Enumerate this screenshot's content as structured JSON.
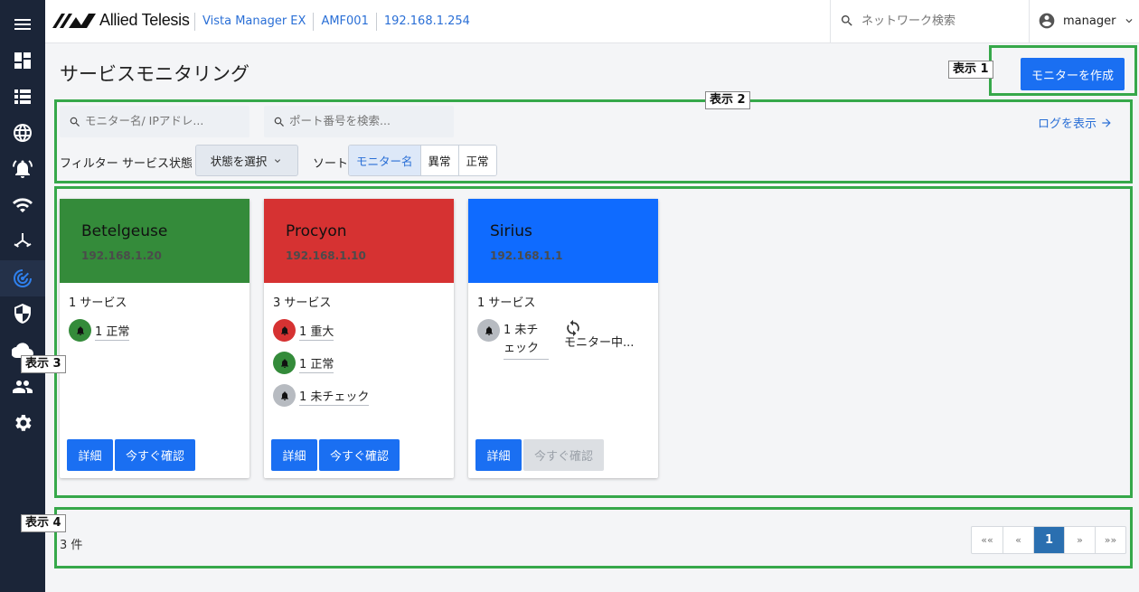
{
  "header": {
    "brand": "Allied Telesis",
    "breadcrumbs": [
      "Vista Manager EX",
      "AMF001",
      "192.168.1.254"
    ],
    "search_placeholder": "ネットワーク検索",
    "user": "manager"
  },
  "sidebar": {
    "items": [
      {
        "icon": "menu-icon"
      },
      {
        "icon": "dashboard-icon"
      },
      {
        "icon": "list-icon"
      },
      {
        "icon": "globe-icon"
      },
      {
        "icon": "alarm-icon"
      },
      {
        "icon": "wifi-icon"
      },
      {
        "icon": "network-topology-icon"
      },
      {
        "icon": "monitoring-icon",
        "active": true
      },
      {
        "icon": "shield-icon"
      },
      {
        "icon": "cloud-icon"
      },
      {
        "icon": "users-icon"
      },
      {
        "icon": "settings-icon"
      }
    ]
  },
  "page": {
    "title": "サービスモニタリング",
    "create_button": "モニターを作成"
  },
  "annotations": [
    "表示 1",
    "表示 2",
    "表示 3",
    "表示 4"
  ],
  "filters": {
    "monitor_search_placeholder": "モニター名/ IPアドレ...",
    "port_search_placeholder": "ポート番号を検索...",
    "logs_link": "ログを表示",
    "filter_label": "フィルター",
    "service_status_label": "サービス状態",
    "status_select": "状態を選択",
    "sort_label": "ソート",
    "sort_options": [
      "モニター名",
      "異常",
      "正常"
    ],
    "sort_active": "モニター名"
  },
  "cards": [
    {
      "name": "Betelgeuse",
      "ip": "192.168.1.20",
      "color": "#348b3a",
      "service_count": "1 サービス",
      "statuses": [
        {
          "label": "1 正常",
          "color": "#348b3a"
        }
      ],
      "detail_label": "詳細",
      "check_label": "今すぐ確認",
      "check_enabled": true
    },
    {
      "name": "Procyon",
      "ip": "192.168.1.10",
      "color": "#d63232",
      "service_count": "3 サービス",
      "statuses": [
        {
          "label": "1 重大",
          "color": "#d63232"
        },
        {
          "label": "1 正常",
          "color": "#348b3a"
        },
        {
          "label": "1 未チェック",
          "color": "#b7bbc1"
        }
      ],
      "detail_label": "詳細",
      "check_label": "今すぐ確認",
      "check_enabled": true
    },
    {
      "name": "Sirius",
      "ip": "192.168.1.1",
      "color": "#0f6bff",
      "service_count": "1 サービス",
      "statuses": [
        {
          "label": "1 未チェック",
          "color": "#b7bbc1"
        }
      ],
      "monitoring_text": "モニター中...",
      "detail_label": "詳細",
      "check_label": "今すぐ確認",
      "check_enabled": false
    }
  ],
  "footer": {
    "count": "3 件",
    "pagination": [
      "««",
      "«",
      "1",
      "»",
      "»»"
    ],
    "current_page": "1"
  },
  "colors": {
    "sidebar_bg": "#1b2538",
    "accent": "#1a6ff2",
    "annotation_border": "#36a84a"
  }
}
